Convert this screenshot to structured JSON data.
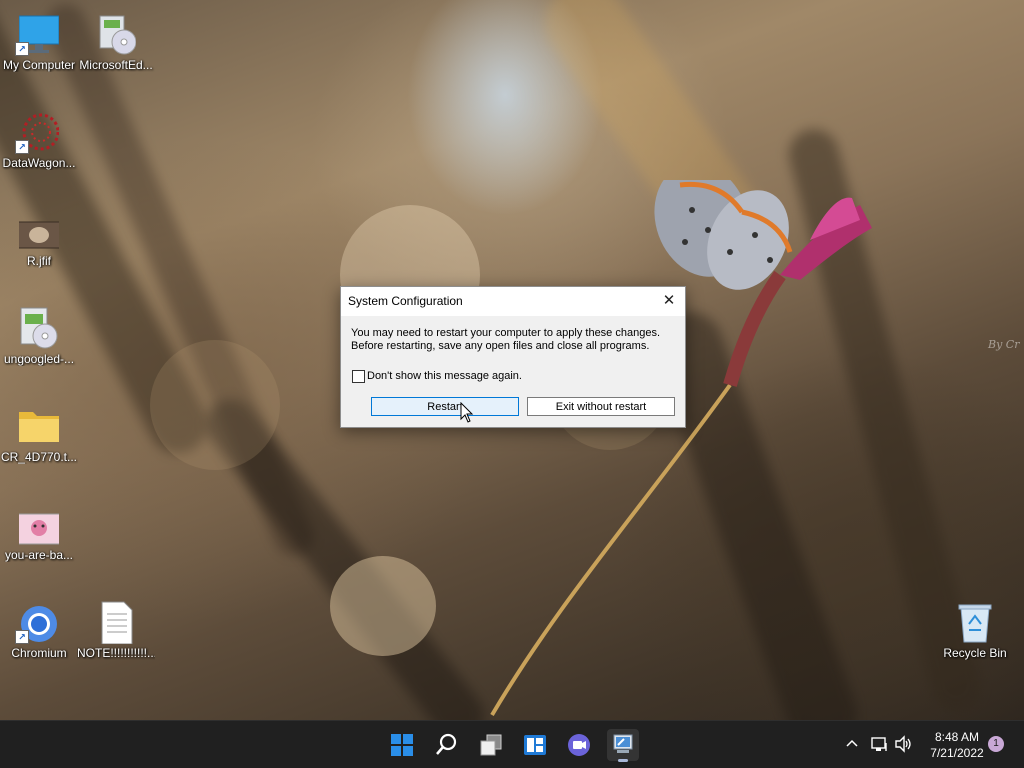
{
  "desktop": {
    "icons": [
      {
        "label": "My Computer",
        "icon": "monitor-icon"
      },
      {
        "label": "MicrosoftEd...",
        "icon": "installer-icon"
      },
      {
        "label": "DataWagon...",
        "icon": "datawagon-icon"
      },
      {
        "label": "R.jfif",
        "icon": "image-file-icon"
      },
      {
        "label": "ungoogled-...",
        "icon": "installer-icon"
      },
      {
        "label": "CR_4D770.t...",
        "icon": "folder-icon"
      },
      {
        "label": "you-are-ba...",
        "icon": "image-file-icon"
      },
      {
        "label": "Chromium",
        "icon": "chromium-icon"
      },
      {
        "label": "NOTE!!!!!!!!!!!....",
        "icon": "text-file-icon"
      },
      {
        "label": "Recycle Bin",
        "icon": "recycle-bin-icon"
      }
    ],
    "wallpaper_signature": "By Cr"
  },
  "dialog": {
    "title": "System Configuration",
    "message_line1": "You may need to restart your computer to apply these changes.",
    "message_line2": "Before restarting, save any open files and close all programs.",
    "checkbox_label": "Don't show this message again.",
    "checkbox_checked": false,
    "restart_label": "Restart",
    "exit_label": "Exit without restart",
    "close_glyph": "✕"
  },
  "taskbar": {
    "apps": [
      {
        "name": "start",
        "icon": "windows-start-icon"
      },
      {
        "name": "search",
        "icon": "search-icon"
      },
      {
        "name": "task-view",
        "icon": "task-view-icon"
      },
      {
        "name": "widgets",
        "icon": "widgets-icon"
      },
      {
        "name": "chat",
        "icon": "teams-chat-icon"
      },
      {
        "name": "system-configuration",
        "icon": "msconfig-icon",
        "active": true
      }
    ],
    "tray": {
      "chevron_glyph": "^",
      "time": "8:48 AM",
      "date": "7/21/2022",
      "notification_count": "1"
    }
  },
  "colors": {
    "taskbar_bg": "#202020",
    "accent": "#0078d7",
    "windows_blue": "#2a8ee8"
  }
}
